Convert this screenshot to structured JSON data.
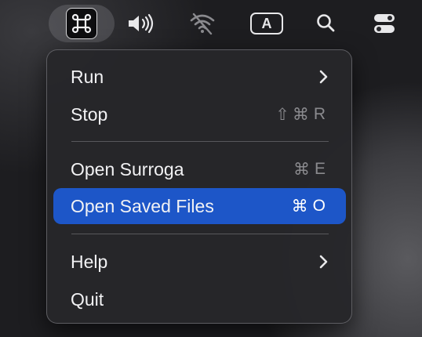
{
  "menubar": {
    "items": [
      {
        "name": "command-app-icon",
        "active": true
      },
      {
        "name": "volume-icon"
      },
      {
        "name": "wifi-off-icon"
      },
      {
        "name": "input-source-icon",
        "label": "A"
      },
      {
        "name": "search-icon"
      },
      {
        "name": "control-center-icon"
      }
    ]
  },
  "menu": {
    "items": [
      {
        "label": "Run",
        "submenu": true
      },
      {
        "label": "Stop",
        "shortcut": "⇧⌘R"
      },
      {
        "label": "Open Surroga",
        "shortcut": "⌘E"
      },
      {
        "label": "Open Saved Files",
        "shortcut": "⌘O",
        "highlighted": true
      },
      {
        "label": "Help",
        "submenu": true
      },
      {
        "label": "Quit"
      }
    ],
    "run_label": "Run",
    "stop_label": "Stop",
    "stop_shortcut_mods": "⇧⌘",
    "stop_shortcut_key": "R",
    "open_surroga_label": "Open Surroga",
    "open_surroga_shortcut_mod": "⌘",
    "open_surroga_shortcut_key": "E",
    "open_saved_label": "Open Saved Files",
    "open_saved_shortcut_mod": "⌘",
    "open_saved_shortcut_key": "O",
    "help_label": "Help",
    "quit_label": "Quit"
  },
  "input_source_label": "A",
  "colors": {
    "highlight": "#1d56c8",
    "menu_bg": "#26262a",
    "shortcut_text": "#8a8a8e"
  }
}
